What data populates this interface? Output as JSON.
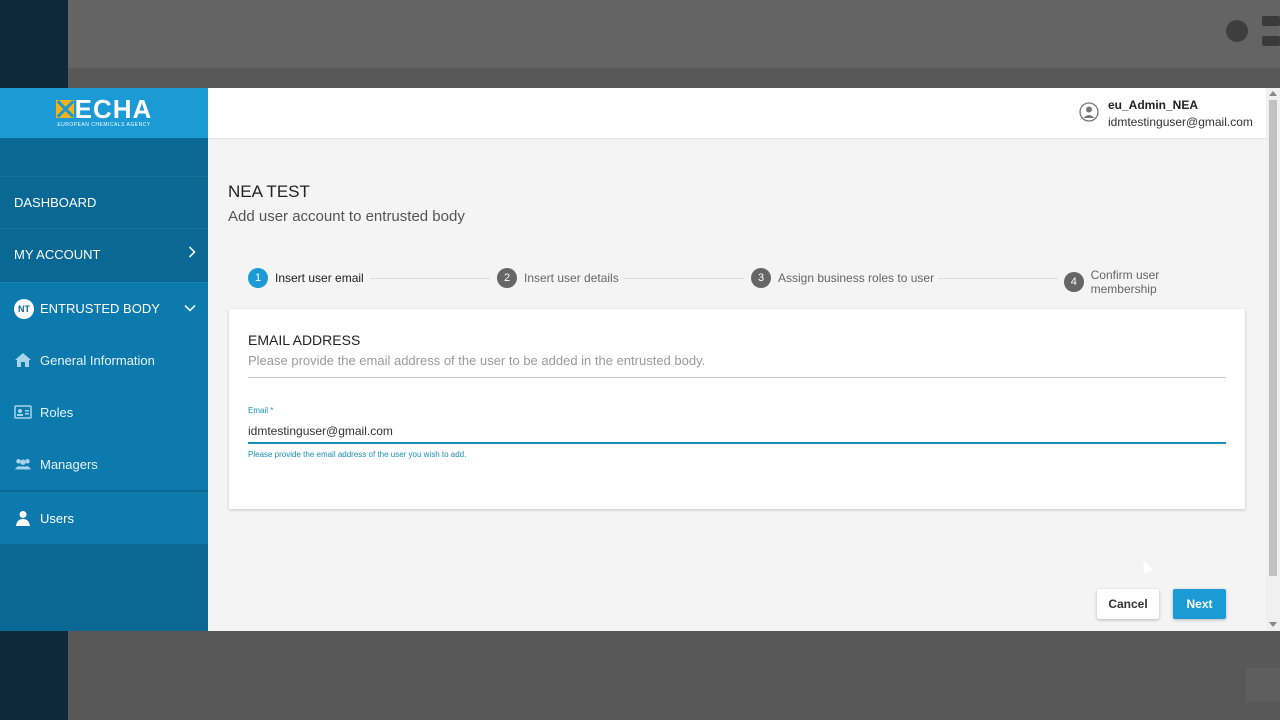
{
  "brand": {
    "logo_text": "ECHA",
    "logo_subtext": "EUROPEAN CHEMICALS AGENCY"
  },
  "sidebar": {
    "dashboard": "DASHBOARD",
    "my_account": "MY ACCOUNT",
    "entrusted_body": {
      "badge": "NT",
      "label": "ENTRUSTED BODY"
    },
    "sub_items": [
      {
        "label": "General Information",
        "icon": "home-icon"
      },
      {
        "label": "Roles",
        "icon": "id-card-icon"
      },
      {
        "label": "Managers",
        "icon": "users-icon"
      },
      {
        "label": "Users",
        "icon": "user-icon"
      }
    ]
  },
  "user": {
    "name": "eu_Admin_NEA",
    "email": "idmtestinguser@gmail.com"
  },
  "page": {
    "title": "NEA TEST",
    "subtitle": "Add user account to entrusted body"
  },
  "steps": [
    {
      "num": "1",
      "label": "Insert user email",
      "active": true
    },
    {
      "num": "2",
      "label": "Insert user details",
      "active": false
    },
    {
      "num": "3",
      "label": "Assign business roles to user",
      "active": false
    },
    {
      "num": "4",
      "label": "Confirm user membership",
      "active": false
    }
  ],
  "form": {
    "section_title": "EMAIL ADDRESS",
    "section_desc": "Please provide the email address of the user to be added in the entrusted body.",
    "email_label": "Email",
    "email_required": "*",
    "email_value": "idmtestinguser@gmail.com",
    "email_hint": "Please provide the email address of the user you wish to add."
  },
  "buttons": {
    "cancel": "Cancel",
    "next": "Next"
  },
  "colors": {
    "accent": "#1b9ad6",
    "sidebar": "#0a6895",
    "field_accent": "#1a8fb3"
  }
}
